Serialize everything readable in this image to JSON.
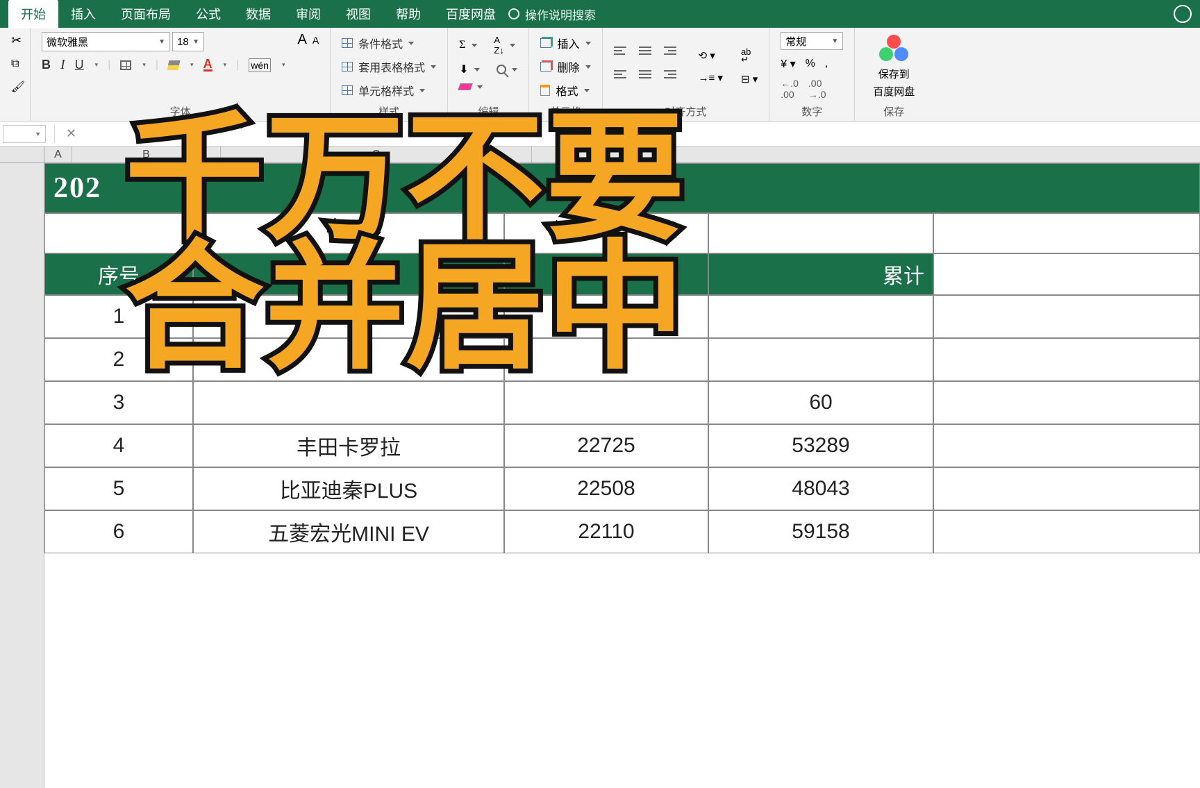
{
  "tabs": {
    "home": "开始",
    "insert": "插入",
    "layout": "页面布局",
    "formula": "公式",
    "data": "数据",
    "review": "审阅",
    "view": "视图",
    "help": "帮助",
    "baidu": "百度网盘",
    "search": "操作说明搜索"
  },
  "ribbon": {
    "font": {
      "name": "微软雅黑",
      "size": "18",
      "bold": "B",
      "italic": "I",
      "underline": "U",
      "wen": "wén",
      "label": "字体",
      "bigA": "A",
      "smallA": "A"
    },
    "style": {
      "cond": "条件格式",
      "table": "套用表格格式",
      "cell": "单元格样式",
      "label": "样式"
    },
    "edit": {
      "sum": "Σ",
      "sort": "A↓Z",
      "fill": "↓",
      "find": "查找",
      "clear": "清除",
      "label": "编辑"
    },
    "cells": {
      "insert": "插入",
      "delete": "删除",
      "format": "格式",
      "label": "单元格"
    },
    "align": {
      "label": "对齐方式",
      "wrap": "ab↵",
      "merge": "合并"
    },
    "number": {
      "sel": "常规",
      "pct": "%",
      "comma": ",",
      "inc": ".0▾",
      "dec": "▴.0",
      "label": "数字",
      "curr": "¥"
    },
    "baidu": {
      "line1": "保存到",
      "line2": "百度网盘",
      "label": "保存"
    }
  },
  "sheet": {
    "col_A": "A",
    "col_B": "B",
    "col_C": "C",
    "title": "202",
    "hdr": {
      "col1": "序号",
      "col2": "车",
      "col4": "累计"
    },
    "rows": [
      {
        "n": "1",
        "model": "",
        "v3": "",
        "v4": ""
      },
      {
        "n": "2",
        "model": "",
        "v3": "",
        "v4": ""
      },
      {
        "n": "3",
        "model": "",
        "v3": "",
        "v4": "60"
      },
      {
        "n": "4",
        "model": "丰田卡罗拉",
        "v3": "22725",
        "v4": "53289"
      },
      {
        "n": "5",
        "model": "比亚迪秦PLUS",
        "v3": "22508",
        "v4": "48043"
      },
      {
        "n": "6",
        "model": "五菱宏光MINI EV",
        "v3": "22110",
        "v4": "59158"
      }
    ]
  },
  "overlay": {
    "line1": "千万不要",
    "line2": "合并居中"
  }
}
